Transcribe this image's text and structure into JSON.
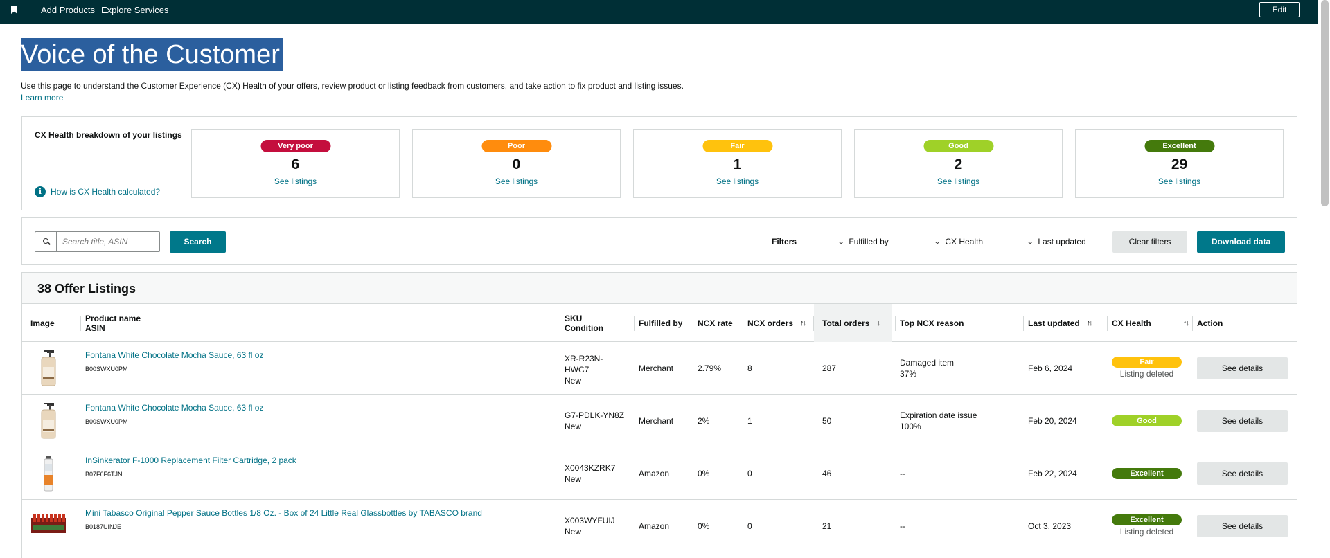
{
  "topbar": {
    "links": [
      "Add Products",
      "Explore Services"
    ],
    "edit_label": "Edit"
  },
  "page": {
    "title": "Voice of the Customer",
    "description": "Use this page to understand the Customer Experience (CX) Health of your offers, review product or listing feedback from customers, and take action to fix product and listing issues.",
    "learn_more": "Learn more"
  },
  "health": {
    "title": "CX Health breakdown of your listings",
    "how_link": "How is CX Health calculated?",
    "cards": [
      {
        "label": "Very poor",
        "count": "6",
        "link": "See listings",
        "color": "#c40e3d"
      },
      {
        "label": "Poor",
        "count": "0",
        "link": "See listings",
        "color": "#ff8c0d"
      },
      {
        "label": "Fair",
        "count": "1",
        "link": "See listings",
        "color": "#ffc20d"
      },
      {
        "label": "Good",
        "count": "2",
        "link": "See listings",
        "color": "#9fd128"
      },
      {
        "label": "Excellent",
        "count": "29",
        "link": "See listings",
        "color": "#447a0c"
      }
    ]
  },
  "filters": {
    "search_placeholder": "Search title, ASIN",
    "search_label": "Search",
    "filters_label": "Filters",
    "dropdowns": [
      "Fulfilled by",
      "CX Health",
      "Last updated"
    ],
    "clear_label": "Clear filters",
    "download_label": "Download data"
  },
  "listings": {
    "title": "38 Offer Listings",
    "columns": {
      "image": "Image",
      "product_name": "Product name",
      "asin": "ASIN",
      "sku": "SKU",
      "condition": "Condition",
      "fulfilled_by": "Fulfilled by",
      "ncx_rate": "NCX rate",
      "ncx_orders": "NCX orders",
      "total_orders": "Total orders",
      "top_reason": "Top NCX reason",
      "last_updated": "Last updated",
      "cx_health": "CX Health",
      "action": "Action"
    },
    "rows": [
      {
        "name": "Fontana White Chocolate Mocha Sauce, 63 fl oz",
        "asin": "B00SWXU0PM",
        "sku_line1": "XR-R23N-",
        "sku_line2": "HWC7",
        "condition": "New",
        "fulfilled_by": "Merchant",
        "ncx_rate": "2.79%",
        "ncx_orders": "8",
        "total_orders": "287",
        "reason": "Damaged item",
        "reason_pct": "37%",
        "last_updated": "Feb 6, 2024",
        "health": "Fair",
        "health_color": "#ffc20d",
        "deleted": "Listing deleted",
        "action": "See details",
        "image": "bottle-image"
      },
      {
        "name": "Fontana White Chocolate Mocha Sauce, 63 fl oz",
        "asin": "B00SWXU0PM",
        "sku_line1": "G7-PDLK-YN8Z",
        "sku_line2": "",
        "condition": "New",
        "fulfilled_by": "Merchant",
        "ncx_rate": "2%",
        "ncx_orders": "1",
        "total_orders": "50",
        "reason": "Expiration date issue",
        "reason_pct": "100%",
        "last_updated": "Feb 20, 2024",
        "health": "Good",
        "health_color": "#9fd128",
        "deleted": "",
        "action": "See details",
        "image": "bottle-image"
      },
      {
        "name": "InSinkerator F-1000 Replacement Filter Cartridge, 2 pack",
        "asin": "B07F6F6TJN",
        "sku_line1": "X0043KZRK7",
        "sku_line2": "",
        "condition": "New",
        "fulfilled_by": "Amazon",
        "ncx_rate": "0%",
        "ncx_orders": "0",
        "total_orders": "46",
        "reason": "--",
        "reason_pct": "",
        "last_updated": "Feb 22, 2024",
        "health": "Excellent",
        "health_color": "#447a0c",
        "deleted": "",
        "action": "See details",
        "image": "filter-image"
      },
      {
        "name": "Mini Tabasco Original Pepper Sauce Bottles 1/8 Oz. - Box of 24 Little Real Glassbottles by TABASCO brand",
        "asin": "B0187UINJE",
        "sku_line1": "X003WYFUIJ",
        "sku_line2": "",
        "condition": "New",
        "fulfilled_by": "Amazon",
        "ncx_rate": "0%",
        "ncx_orders": "0",
        "total_orders": "21",
        "reason": "--",
        "reason_pct": "",
        "last_updated": "Oct 3, 2023",
        "health": "Excellent",
        "health_color": "#447a0c",
        "deleted": "Listing deleted",
        "action": "See details",
        "image": "tabasco-box-image"
      }
    ]
  }
}
